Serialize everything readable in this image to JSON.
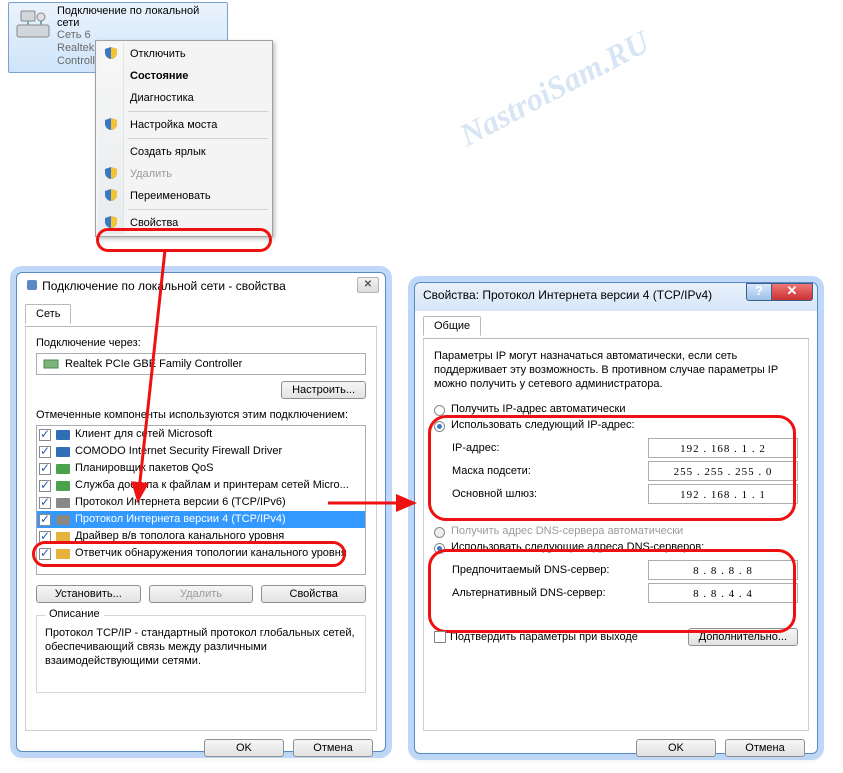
{
  "watermark": "NastroiSam.RU",
  "adapter": {
    "title": "Подключение по локальной сети",
    "line2": "Сеть 6",
    "line3": "Realtek PCIe GBE Family Controll..."
  },
  "context_menu": {
    "items": [
      {
        "label": "Отключить",
        "shield": true
      },
      {
        "label": "Состояние",
        "bold": true
      },
      {
        "label": "Диагностика"
      },
      {
        "sep": true
      },
      {
        "label": "Настройка моста",
        "shield": true
      },
      {
        "sep": true
      },
      {
        "label": "Создать ярлык"
      },
      {
        "label": "Удалить",
        "shield": true,
        "disabled": true
      },
      {
        "label": "Переименовать",
        "shield": true
      },
      {
        "sep": true
      },
      {
        "label": "Свойства",
        "shield": true
      }
    ]
  },
  "props_dialog": {
    "title": "Подключение по локальной сети - свойства",
    "tab": "Сеть",
    "connect_using_label": "Подключение через:",
    "adapter_name": "Realtek PCIe GBE Family Controller",
    "configure_btn": "Настроить...",
    "components_label": "Отмеченные компоненты используются этим подключением:",
    "components": [
      {
        "label": "Клиент для сетей Microsoft",
        "checked": true,
        "color": "#2e6fb7"
      },
      {
        "label": "COMODO Internet Security Firewall Driver",
        "checked": true,
        "color": "#2e6fb7"
      },
      {
        "label": "Планировщик пакетов QoS",
        "checked": true,
        "color": "#4aa34a"
      },
      {
        "label": "Служба доступа к файлам и принтерам сетей Micro...",
        "checked": true,
        "color": "#4aa34a"
      },
      {
        "label": "Протокол Интернета версии 6 (TCP/IPv6)",
        "checked": true,
        "color": "#888"
      },
      {
        "label": "Протокол Интернета версии 4 (TCP/IPv4)",
        "checked": true,
        "color": "#888",
        "selected": true
      },
      {
        "label": "Драйвер в/в тополога канального уровня",
        "checked": true,
        "color": "#e6b23c"
      },
      {
        "label": "Ответчик обнаружения топологии канального уровня",
        "checked": true,
        "color": "#e6b23c"
      }
    ],
    "install_btn": "Установить...",
    "remove_btn": "Удалить",
    "properties_btn": "Свойства",
    "desc_title": "Описание",
    "desc_text": "Протокол TCP/IP - стандартный протокол глобальных сетей, обеспечивающий связь между различными взаимодействующими сетями.",
    "ok": "OK",
    "cancel": "Отмена"
  },
  "ipv4_dialog": {
    "title": "Свойства: Протокол Интернета версии 4 (TCP/IPv4)",
    "tab": "Общие",
    "intro": "Параметры IP могут назначаться автоматически, если сеть поддерживает эту возможность. В противном случае параметры IP можно получить у сетевого администратора.",
    "ip_auto": "Получить IP-адрес автоматически",
    "ip_manual": "Использовать следующий IP-адрес:",
    "lbl_ip": "IP-адрес:",
    "val_ip": "192 . 168 .  1  .  2",
    "lbl_mask": "Маска подсети:",
    "val_mask": "255 . 255 . 255 .  0",
    "lbl_gw": "Основной шлюз:",
    "val_gw": "192 . 168 .  1  .  1",
    "dns_auto": "Получить адрес DNS-сервера автоматически",
    "dns_manual": "Использовать следующие адреса DNS-серверов:",
    "lbl_dns1": "Предпочитаемый DNS-сервер:",
    "val_dns1": "8  .  8  .  8  .  8",
    "lbl_dns2": "Альтернативный DNS-сервер:",
    "val_dns2": "8  .  8  .  4  .  4",
    "validate": "Подтвердить параметры при выходе",
    "advanced": "Дополнительно...",
    "ok": "OK",
    "cancel": "Отмена"
  }
}
